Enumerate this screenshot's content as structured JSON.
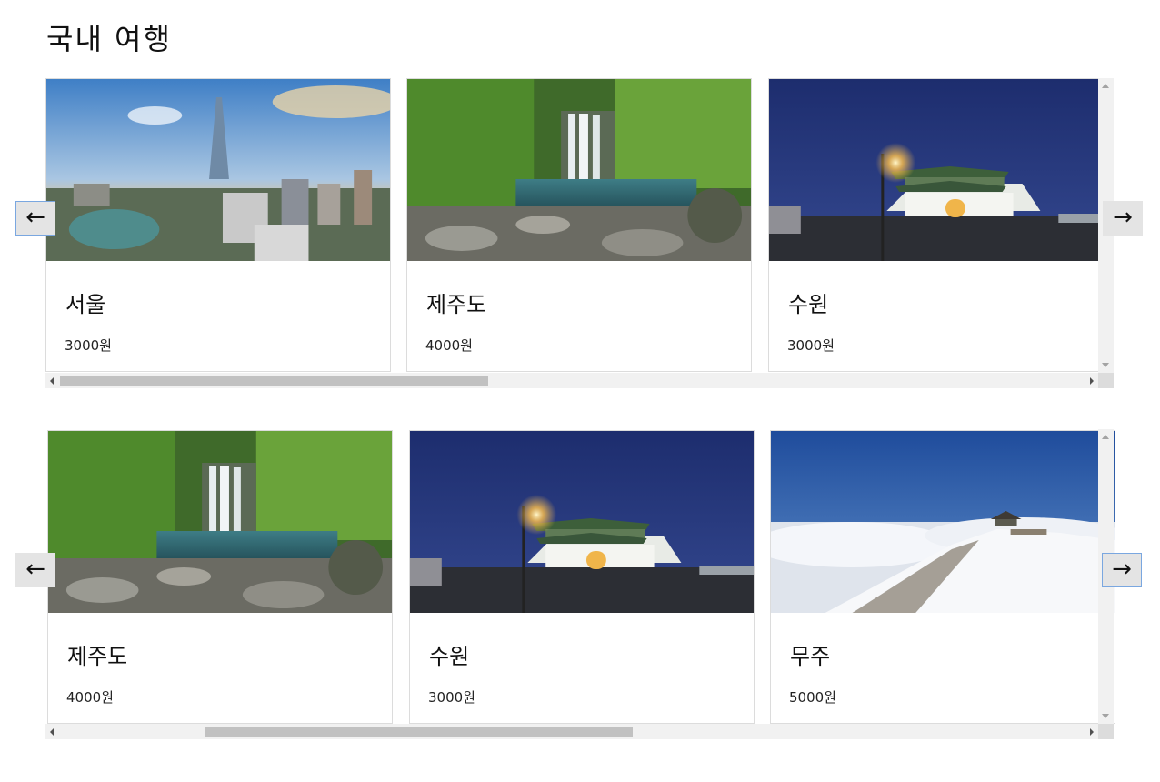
{
  "page": {
    "title": "국내 여행"
  },
  "carousel1": {
    "prev_label": "←",
    "next_label": "→",
    "scroll_position": 0.0,
    "cards": [
      {
        "name": "서울",
        "price": "3000원",
        "image": "seoul-skyline-photo"
      },
      {
        "name": "제주도",
        "price": "4000원",
        "image": "jeju-waterfall-photo"
      },
      {
        "name": "수원",
        "price": "3000원",
        "image": "suwon-gate-night-photo"
      }
    ]
  },
  "carousel2": {
    "prev_label": "←",
    "next_label": "→",
    "scroll_position": 0.35,
    "cards": [
      {
        "name": "제주도",
        "price": "4000원",
        "image": "jeju-waterfall-photo"
      },
      {
        "name": "수원",
        "price": "3000원",
        "image": "suwon-gate-night-photo"
      },
      {
        "name": "무주",
        "price": "5000원",
        "image": "muju-snow-mountain-photo"
      }
    ]
  }
}
